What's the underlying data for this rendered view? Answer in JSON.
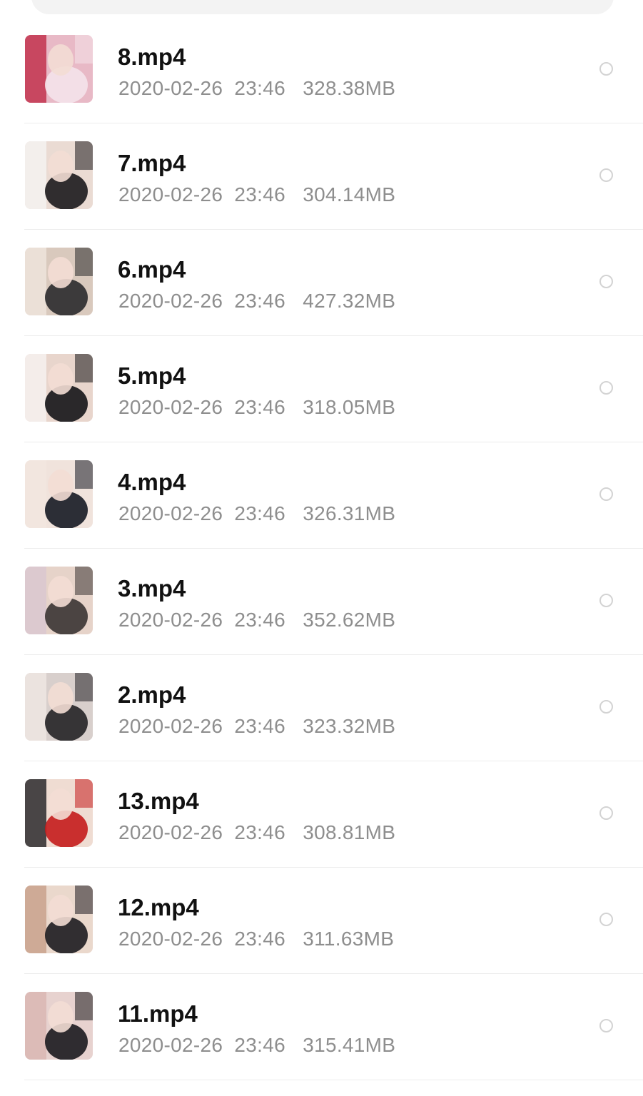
{
  "files": [
    {
      "name": "8.mp4",
      "date": "2020-02-26",
      "time": "23:46",
      "size": "328.38MB",
      "thumb_colors": [
        "#e8b9c6",
        "#f4e3ea",
        "#c2324d"
      ]
    },
    {
      "name": "7.mp4",
      "date": "2020-02-26",
      "time": "23:46",
      "size": "304.14MB",
      "thumb_colors": [
        "#eadbd3",
        "#1c1a1d",
        "#f5f2f0"
      ]
    },
    {
      "name": "6.mp4",
      "date": "2020-02-26",
      "time": "23:46",
      "size": "427.32MB",
      "thumb_colors": [
        "#d9c9bd",
        "#2a2a2c",
        "#ede4dc"
      ]
    },
    {
      "name": "5.mp4",
      "date": "2020-02-26",
      "time": "23:46",
      "size": "318.05MB",
      "thumb_colors": [
        "#e8d5cc",
        "#151518",
        "#f6f1ee"
      ]
    },
    {
      "name": "4.mp4",
      "date": "2020-02-26",
      "time": "23:46",
      "size": "326.31MB",
      "thumb_colors": [
        "#f0e3dc",
        "#161a24",
        "#f2e6df"
      ]
    },
    {
      "name": "3.mp4",
      "date": "2020-02-26",
      "time": "23:46",
      "size": "352.62MB",
      "thumb_colors": [
        "#e6d3c9",
        "#3a3433",
        "#d9c7d0"
      ]
    },
    {
      "name": "2.mp4",
      "date": "2020-02-26",
      "time": "23:46",
      "size": "323.32MB",
      "thumb_colors": [
        "#d8cfcc",
        "#252226",
        "#efe6e2"
      ]
    },
    {
      "name": "13.mp4",
      "date": "2020-02-26",
      "time": "23:46",
      "size": "308.81MB",
      "thumb_colors": [
        "#efdcd2",
        "#c41c1c",
        "#2c2a2e"
      ]
    },
    {
      "name": "12.mp4",
      "date": "2020-02-26",
      "time": "23:46",
      "size": "311.63MB",
      "thumb_colors": [
        "#ead8cc",
        "#1d1c20",
        "#c9a28c"
      ]
    },
    {
      "name": "11.mp4",
      "date": "2020-02-26",
      "time": "23:46",
      "size": "315.41MB",
      "thumb_colors": [
        "#e7d2cf",
        "#1b1a1e",
        "#d9b7b3"
      ]
    }
  ]
}
